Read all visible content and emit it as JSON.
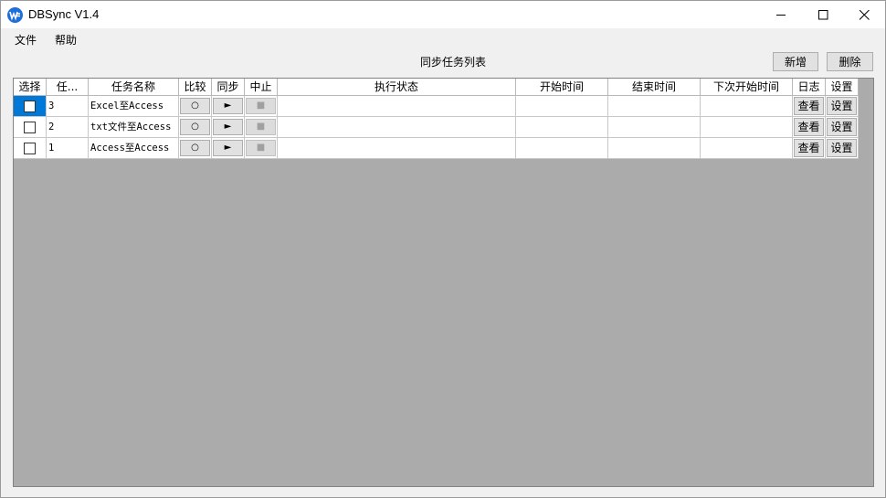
{
  "window": {
    "title": "DBSync V1.4",
    "brand_color": "#1e6fd9"
  },
  "menu": {
    "items": [
      "文件",
      "帮助"
    ]
  },
  "toolbar": {
    "list_title": "同步任务列表",
    "add_label": "新增",
    "delete_label": "删除"
  },
  "table": {
    "headers": [
      "选择",
      "任...",
      "任务名称",
      "比较",
      "同步",
      "中止",
      "执行状态",
      "开始时间",
      "结束时间",
      "下次开始时间",
      "日志",
      "设置"
    ],
    "compare_glyph": "○",
    "sync_glyph": "►",
    "stop_glyph": "■",
    "log_label": "查看",
    "settings_label": "设置",
    "selection_color": "#0078d7",
    "rows": [
      {
        "id": "3",
        "name": "Excel至Access",
        "status": "",
        "start": "",
        "end": "",
        "next": "",
        "checked": false
      },
      {
        "id": "2",
        "name": "txt文件至Access",
        "status": "",
        "start": "",
        "end": "",
        "next": "",
        "checked": false
      },
      {
        "id": "1",
        "name": "Access至Access",
        "status": "",
        "start": "",
        "end": "",
        "next": "",
        "checked": false
      }
    ]
  }
}
